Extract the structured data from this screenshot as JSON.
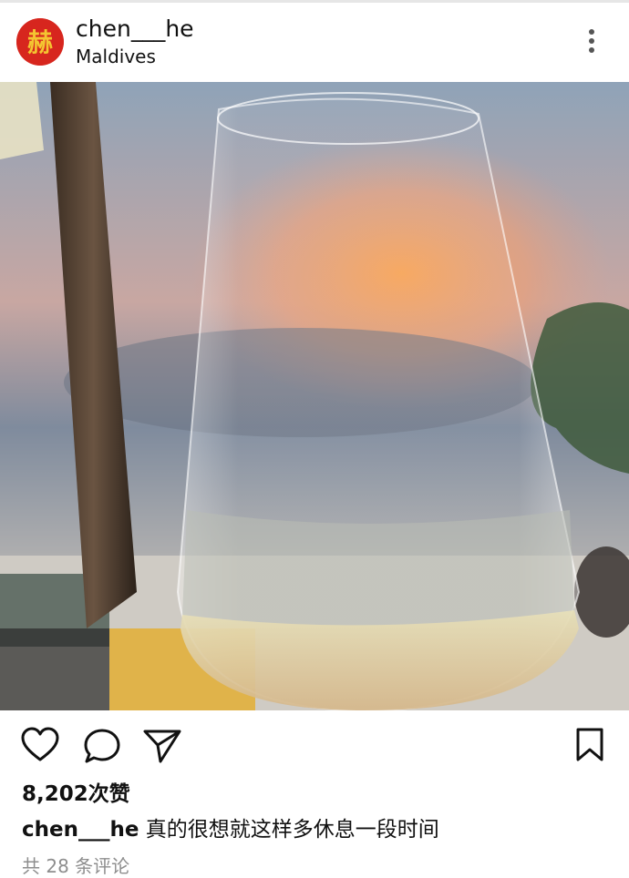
{
  "post": {
    "username": "chen___he",
    "location": "Maldives",
    "avatar_glyph": "赫",
    "likes": "8,202次赞",
    "caption_user": "chen___he",
    "caption_text": " 真的很想就这样多休息一段时间",
    "view_comments": "共 28 条评论"
  },
  "icons": {
    "more": "more-vertical-icon",
    "like": "heart-icon",
    "comment": "comment-icon",
    "share": "send-icon",
    "save": "bookmark-icon"
  },
  "colors": {
    "avatar_bg": "#d7261e",
    "avatar_glyph": "#f4c531",
    "text": "#111111",
    "muted": "#8e8e8e"
  }
}
